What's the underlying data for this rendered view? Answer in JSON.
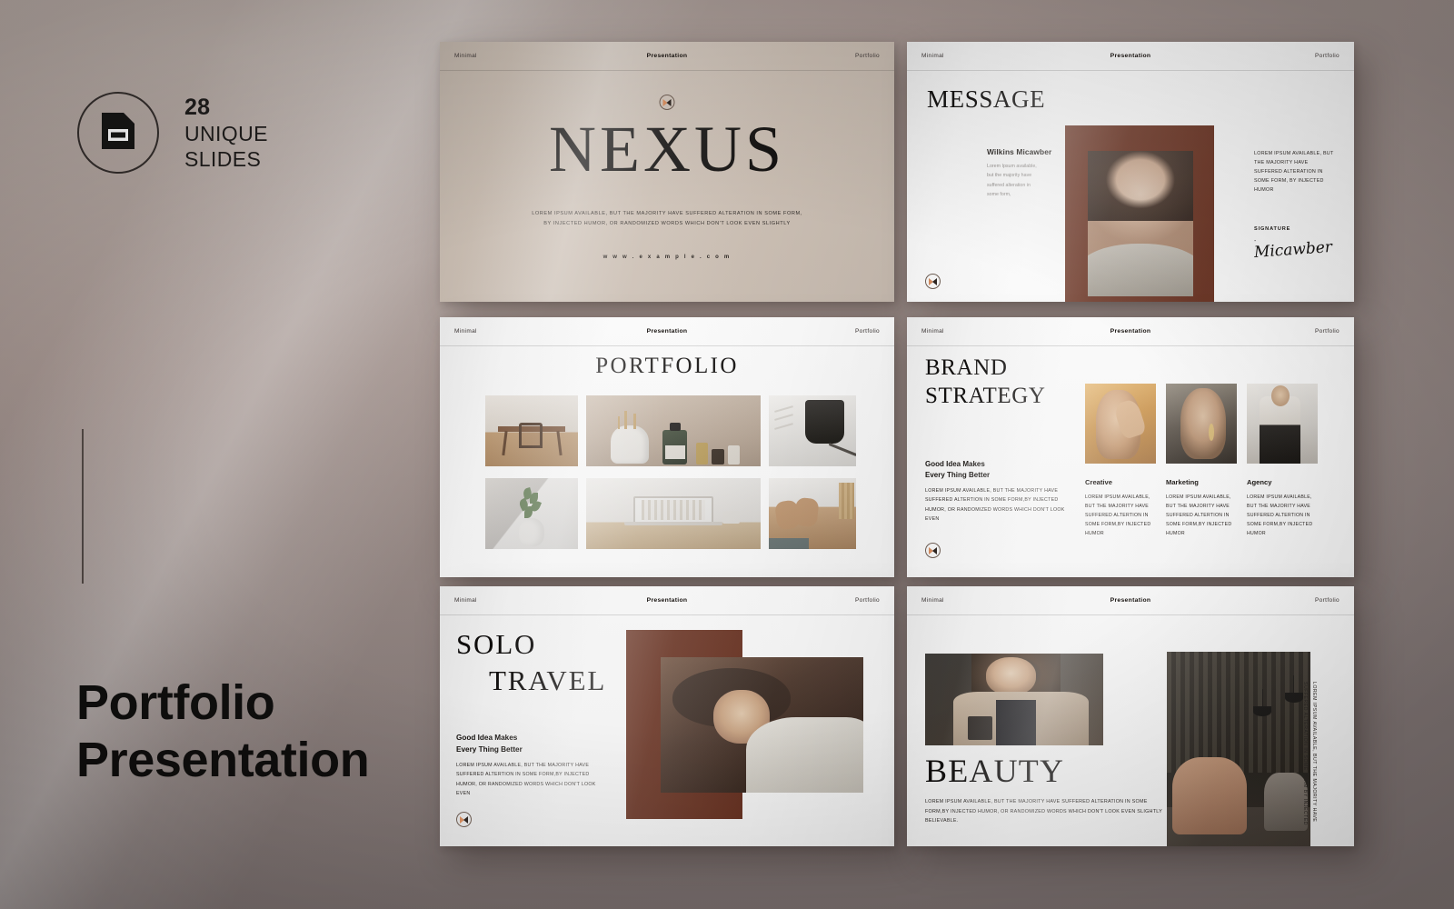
{
  "backdrop": {
    "base_color": "#9b908c",
    "highlight_color": "#b6aaa4"
  },
  "left_panel": {
    "badge": {
      "icon": "slide-document-icon",
      "count": "28",
      "line1": "UNIQUE",
      "line2": "SLIDES"
    },
    "divider": "vertical-rule",
    "title_line1": "Portfolio",
    "title_line2": "Presentation"
  },
  "slide_header": {
    "left": "Minimal",
    "center": "Presentation",
    "right": "Portfolio"
  },
  "logo": {
    "name": "nexus-logo-mark",
    "left_color": "#d08a5e",
    "right_color": "#2e2622"
  },
  "accent_color": "#6b3322",
  "slides": [
    {
      "id": "slide-1-cover",
      "title": "NEXUS",
      "subtitle": "LOREM IPSUM AVAILABLE, BUT THE MAJORITY HAVE SUFFERED ALTERATION  IN SOME FORM, BY INJECTED HUMOR, OR RANDOMIZED  WORDS WHICH DON'T LOOK EVEN SLIGHTLY",
      "url": "w w w . e x a m p l e . c o m"
    },
    {
      "id": "slide-2-message",
      "title": "MESSAGE",
      "author": "Wilkins Micawber",
      "author_body": "Lorem Ipsum available,  but the majority  have suffered alteration in some form,",
      "right_body": "LOREM IPSUM AVAILABLE, BUT THE MAJORITY HAVE SUFFERED ALTERATION IN SOME FORM, BY INJECTED HUMOR",
      "signature_label": "SIGNATURE",
      "signature_dash": "-",
      "signature_script": "Micawber"
    },
    {
      "id": "slide-3-portfolio",
      "title": "PORTFOLIO",
      "gallery": [
        "dining-room-photo",
        "skincare-bottles-photo",
        "black-mug-photo",
        "white-vase-plant-photo",
        "laptop-desk-photo",
        "tan-sofa-photo"
      ]
    },
    {
      "id": "slide-4-brand-strategy",
      "title_line1": "BRAND",
      "title_line2": "STRATEGY",
      "heading_line1": "Good Idea Makes",
      "heading_line2": "Every Thing Better",
      "body": "LOREM IPSUM AVAILABLE, BUT THE MAJORITY HAVE SUFFERED ALTERTION IN SOME FORM,BY INJECTED HUMOR, OR RANDOMIZED  WORDS WHICH DON'T LOOK EVEN",
      "columns": [
        {
          "title": "Creative",
          "body": "LOREM IPSUM AVAILABLE, BUT THE MAJORITY HAVE SUFFERED ALTERTION IN SOME FORM,BY INJECTED HUMOR"
        },
        {
          "title": "Marketing",
          "body": "LOREM IPSUM AVAILABLE, BUT THE MAJORITY HAVE SUFFERED ALTERTION IN SOME FORM,BY INJECTED HUMOR"
        },
        {
          "title": "Agency",
          "body": "LOREM IPSUM AVAILABLE, BUT THE MAJORITY HAVE SUFFERED ALTERTION IN SOME FORM,BY INJECTED HUMOR"
        }
      ]
    },
    {
      "id": "slide-5-solo-travel",
      "title_line1": "SOLO",
      "title_line2": "TRAVEL",
      "heading_line1": "Good Idea Makes",
      "heading_line2": "Every Thing Better",
      "body": "LOREM IPSUM AVAILABLE,  BUT THE MAJORITY HAVE SUFFERED ALTERTION  IN SOME  FORM,BY INJECTED HUMOR, OR RANDOMIZED  WORDS WHICH DON'T LOOK EVEN"
    },
    {
      "id": "slide-6-beauty",
      "title": "BEAUTY",
      "body": "LOREM IPSUM AVAILABLE, BUT THE MAJORITY  HAVE SUFFERED ALTERATION IN SOME FORM,BY INJECTED HUMOR, OR RANDOMIZED  WORDS WHICH DON'T LOOK EVEN SLIGHTLY BELIEVABLE.",
      "vertical_text": "LOREM IPSUM AVAILABLE, BUT THE MAJORITY HAVE SUFFERED ALTERATION IN SOME FORM BY INJECTED"
    }
  ]
}
